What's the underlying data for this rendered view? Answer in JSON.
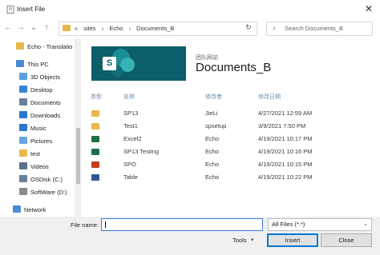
{
  "window": {
    "title": "Insert File"
  },
  "address": {
    "crumbs": [
      "«",
      "sites",
      "›",
      "Echo",
      "›",
      "Documents_B"
    ],
    "search_placeholder": "Search Documents_B"
  },
  "nav": [
    {
      "label": "Echo - Translatio",
      "icon": "folder-icon",
      "color": "#e8b84a"
    },
    {
      "label": "This PC",
      "icon": "computer-icon",
      "color": "#4a8bd6"
    },
    {
      "label": "3D Objects",
      "icon": "cube-icon",
      "color": "#5aa0e6"
    },
    {
      "label": "Desktop",
      "icon": "desktop-icon",
      "color": "#3b82d0"
    },
    {
      "label": "Documents",
      "icon": "documents-icon",
      "color": "#6b7f9a"
    },
    {
      "label": "Downloads",
      "icon": "download-icon",
      "color": "#2b78cf"
    },
    {
      "label": "Music",
      "icon": "music-icon",
      "color": "#2b78cf"
    },
    {
      "label": "Pictures",
      "icon": "pictures-icon",
      "color": "#6aa4e2"
    },
    {
      "label": "test",
      "icon": "folder-icon",
      "color": "#e8b84a"
    },
    {
      "label": "Videos",
      "icon": "video-icon",
      "color": "#5a6f8c"
    },
    {
      "label": "OSDisk (C:)",
      "icon": "disk-icon",
      "color": "#6a7f98"
    },
    {
      "label": "SoftWare (D:)",
      "icon": "drive-icon",
      "color": "#8a8a8a"
    },
    {
      "label": "Network",
      "icon": "network-icon",
      "color": "#4a8bd6"
    }
  ],
  "site": {
    "subtitle": "团队网站",
    "title": "Documents_B",
    "logo_letter": "S"
  },
  "columns": [
    "类型",
    "名称",
    "修改者",
    "修改日期"
  ],
  "files": [
    {
      "icon": "folder-icon",
      "color": "#e8b84a",
      "name": "SP13",
      "modified_by": "JieLi",
      "modified": "4/27/2021 12:59 AM"
    },
    {
      "icon": "folder-icon",
      "color": "#e8b84a",
      "name": "Test1",
      "modified_by": "spsetup",
      "modified": "3/9/2021 7:50 PM"
    },
    {
      "icon": "excel-icon",
      "color": "#1e7145",
      "name": "Excel2",
      "modified_by": "Echo",
      "modified": "4/19/2021 10:17 PM"
    },
    {
      "icon": "excel-icon",
      "color": "#1e7145",
      "name": "SP13 Testing",
      "modified_by": "Echo",
      "modified": "4/19/2021 10:16 PM"
    },
    {
      "icon": "powerpoint-icon",
      "color": "#c43e1c",
      "name": "SPO",
      "modified_by": "Echo",
      "modified": "4/19/2021 10:15 PM"
    },
    {
      "icon": "word-icon",
      "color": "#2b579a",
      "name": "Table",
      "modified_by": "Echo",
      "modified": "4/19/2021 10:22 PM"
    }
  ],
  "footer": {
    "file_name_label": "File name:",
    "file_name_value": "",
    "filter": "All Files (*.*)",
    "tools_label": "Tools",
    "insert_label": "Insert",
    "close_label": "Close"
  }
}
